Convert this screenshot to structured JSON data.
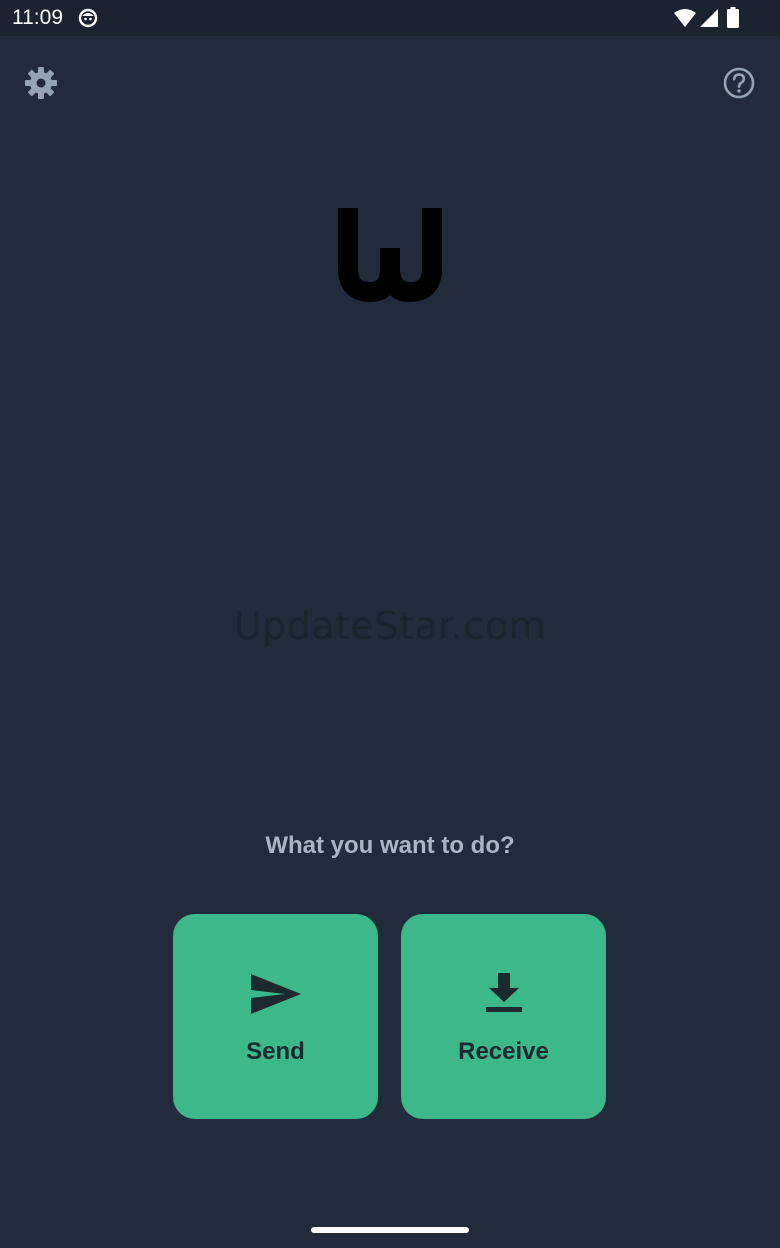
{
  "status_bar": {
    "time": "11:09",
    "icons": [
      "app-notification-icon",
      "wifi-icon",
      "signal-icon",
      "battery-icon"
    ]
  },
  "header": {
    "settings_icon": "gear-icon",
    "help_icon": "help-circle-icon"
  },
  "logo": {
    "icon": "w-logo-icon"
  },
  "watermark": {
    "text": "UpdateStar.com"
  },
  "main": {
    "prompt": "What you want to do?",
    "actions": [
      {
        "label": "Send",
        "icon": "send-icon"
      },
      {
        "label": "Receive",
        "icon": "download-icon"
      }
    ]
  },
  "colors": {
    "background": "#222b3b",
    "status_bar": "#1b2230",
    "accent": "#3db88b",
    "prompt_text": "#aab6c4",
    "button_text": "#1c2a2e"
  }
}
